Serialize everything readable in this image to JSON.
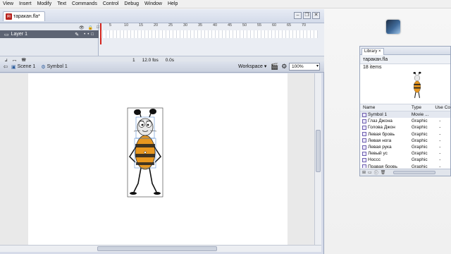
{
  "menu": [
    "View",
    "Insert",
    "Modify",
    "Text",
    "Commands",
    "Control",
    "Debug",
    "Window",
    "Help"
  ],
  "document": {
    "tab_title": "таракан.fla*",
    "file_icon": "Fl"
  },
  "window_buttons": {
    "minimize": "–",
    "restore": "❐",
    "close": "✕"
  },
  "timeline": {
    "header_icons": [
      "👁",
      "🔒",
      "□"
    ],
    "layer_name": "Layer 1",
    "frame_numbers": [
      "1",
      "5",
      "10",
      "15",
      "20",
      "25",
      "30",
      "35",
      "40",
      "45",
      "50",
      "55",
      "60",
      "65",
      "70"
    ],
    "current_frame": "1",
    "fps": "12.0 fps",
    "time": "0.0s"
  },
  "editbar": {
    "scene_label": "Scene 1",
    "symbol_label": "Symbol 1",
    "workspace_label": "Workspace",
    "zoom_value": "100%"
  },
  "library": {
    "tab_label": "Library",
    "file_name": "таракан.fla",
    "item_count": "18 items",
    "columns": {
      "name": "Name",
      "type": "Type",
      "use": "Use Co"
    },
    "items": [
      {
        "name": "Symbol 1",
        "type": "Movie ...",
        "use": ""
      },
      {
        "name": "Глаз Джона",
        "type": "Graphic",
        "use": "-"
      },
      {
        "name": "Голова Джон",
        "type": "Graphic",
        "use": "-"
      },
      {
        "name": "Левая бровь",
        "type": "Graphic",
        "use": "-"
      },
      {
        "name": "Левая нога",
        "type": "Graphic",
        "use": "-"
      },
      {
        "name": "Левая рука",
        "type": "Graphic",
        "use": "-"
      },
      {
        "name": "Левый ус",
        "type": "Graphic",
        "use": "-"
      },
      {
        "name": "Носсс",
        "type": "Graphic",
        "use": "-"
      },
      {
        "name": "Правая бровь",
        "type": "Graphic",
        "use": "-"
      }
    ]
  },
  "colors": {
    "playhead": "#d3241d",
    "layer_row": "#5d6473",
    "body_orange": "#e8971f",
    "selection": "#3a78c8"
  }
}
